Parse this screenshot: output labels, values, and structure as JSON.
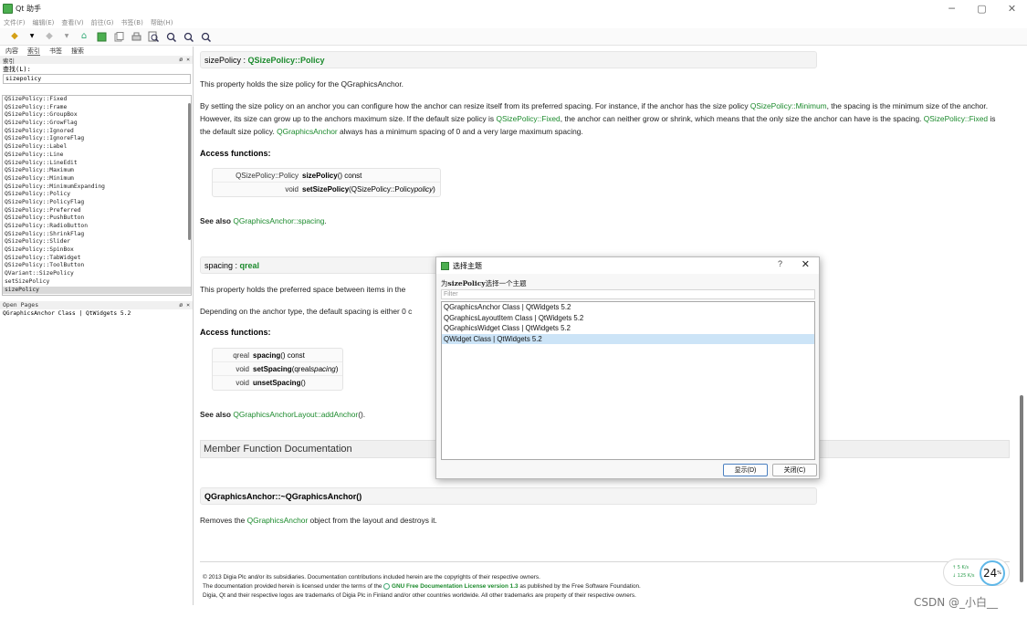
{
  "window": {
    "title": "Qt 助手",
    "min": "─",
    "max": "▢",
    "close": "✕"
  },
  "menu": [
    "文件(F)",
    "编辑(E)",
    "查看(V)",
    "前往(G)",
    "书签(B)",
    "帮助(H)"
  ],
  "toolbar_icons": [
    "back-icon",
    "forward-icon",
    "home-icon",
    "sync-icon",
    "copy-icon",
    "print-icon",
    "find-icon",
    "zoom-in-icon",
    "zoom-out-icon",
    "zoom-reset-icon"
  ],
  "left": {
    "tabs": [
      "内容",
      "索引",
      "书签",
      "搜索"
    ],
    "index_header": "索引",
    "find_label": "查找(L):",
    "find_value": "sizepolicy",
    "items": [
      "QSizePolicy::Fixed",
      "QSizePolicy::Frame",
      "QSizePolicy::GroupBox",
      "QSizePolicy::GrowFlag",
      "QSizePolicy::Ignored",
      "QSizePolicy::IgnoreFlag",
      "QSizePolicy::Label",
      "QSizePolicy::Line",
      "QSizePolicy::LineEdit",
      "QSizePolicy::Maximum",
      "QSizePolicy::Minimum",
      "QSizePolicy::MinimumExpanding",
      "QSizePolicy::Policy",
      "QSizePolicy::PolicyFlag",
      "QSizePolicy::Preferred",
      "QSizePolicy::PushButton",
      "QSizePolicy::RadioButton",
      "QSizePolicy::ShrinkFlag",
      "QSizePolicy::Slider",
      "QSizePolicy::SpinBox",
      "QSizePolicy::TabWidget",
      "QSizePolicy::ToolButton",
      "QVariant::SizePolicy",
      "setSizePolicy",
      "sizePolicy"
    ],
    "open_pages_header": "Open Pages",
    "open_pages": [
      "QGraphicsAnchor Class | QtWidgets 5.2"
    ],
    "panel_ctrl": "ø ×"
  },
  "content": {
    "prop1_name": "sizePolicy",
    "prop1_type": "QSizePolicy::Policy",
    "prop1_summary": "This property holds the size policy for the QGraphicsAnchor.",
    "prop1_desc_a": "By setting the size policy on an anchor you can configure how the anchor can resize itself from its preferred spacing. For instance, if the anchor has the size policy ",
    "prop1_link_a": "QSizePolicy::Minimum",
    "prop1_desc_b": ", the spacing is the minimum size of the anchor. However, its size can grow up to the anchors maximum size. If the default size policy is ",
    "prop1_link_b": "QSizePolicy::Fixed",
    "prop1_desc_c": ", the anchor can neither grow or shrink, which means that the only size the anchor can have is the spacing. ",
    "prop1_link_c": "QSizePolicy::Fixed",
    "prop1_desc_d": " is the default size policy. ",
    "prop1_link_d": "QGraphicsAnchor",
    "prop1_desc_e": " always has a minimum spacing of 0 and a very large maximum spacing.",
    "access_label": "Access functions:",
    "prop1_fns": [
      {
        "type": "QSizePolicy::Policy",
        "name": "sizePolicy",
        "args": "() const"
      },
      {
        "type": "void",
        "name": "setSizePolicy",
        "args": "(QSizePolicy::Policy ",
        "arg_it": "policy",
        "end": ")"
      }
    ],
    "see_also": "See also",
    "prop1_see": "QGraphicsAnchor::spacing",
    "prop2_name": "spacing",
    "prop2_type": "qreal",
    "prop2_summary": "This property holds the preferred space between items in the",
    "prop2_desc": "Depending on the anchor type, the default spacing is either 0 c",
    "prop2_fns": [
      {
        "type": "qreal",
        "name": "spacing",
        "args": "() const"
      },
      {
        "type": "void",
        "name": "setSpacing",
        "args": "(qreal ",
        "arg_it": "spacing",
        "end": ")"
      },
      {
        "type": "void",
        "name": "unsetSpacing",
        "args": "()"
      }
    ],
    "prop2_see": "QGraphicsAnchorLayout::addAnchor",
    "member_heading": "Member Function Documentation",
    "dtor_title": "QGraphicsAnchor::~QGraphicsAnchor()",
    "dtor_desc_a": "Removes the ",
    "dtor_link": "QGraphicsAnchor",
    "dtor_desc_b": " object from the layout and destroys it.",
    "footer_1": "© 2013 Digia Plc and/or its subsidiaries. Documentation contributions included herein are the copyrights of their respective owners.",
    "footer_2a": "The documentation provided herein is licensed under the terms of the",
    "footer_2b": "GNU Free Documentation License version 1.3",
    "footer_2c": "as published by the Free Software Foundation.",
    "footer_3": "Digia, Qt and their respective logos are trademarks of Digia Plc in Finland and/or other countries worldwide. All other trademarks are property of their respective owners."
  },
  "dialog": {
    "title": "选择主题",
    "help": "?",
    "close": "✕",
    "label_prefix": "为",
    "label_bold": "sizePolicy",
    "label_suffix": "选择一个主题",
    "filter_placeholder": "Filter",
    "items": [
      "QGraphicsAnchor Class | QtWidgets 5.2",
      "QGraphicsLayoutItem Class | QtWidgets 5.2",
      "QGraphicsWidget Class | QtWidgets 5.2",
      "QWidget Class | QtWidgets 5.2"
    ],
    "selected_index": 3,
    "show_btn": "显示(D)",
    "close_btn": "关闭(C)"
  },
  "speed": {
    "up": "↑ 5  K/s",
    "down": "↓ 125 K/s",
    "percent": "24",
    "unit": "%"
  },
  "watermark": "CSDN @_小白__"
}
